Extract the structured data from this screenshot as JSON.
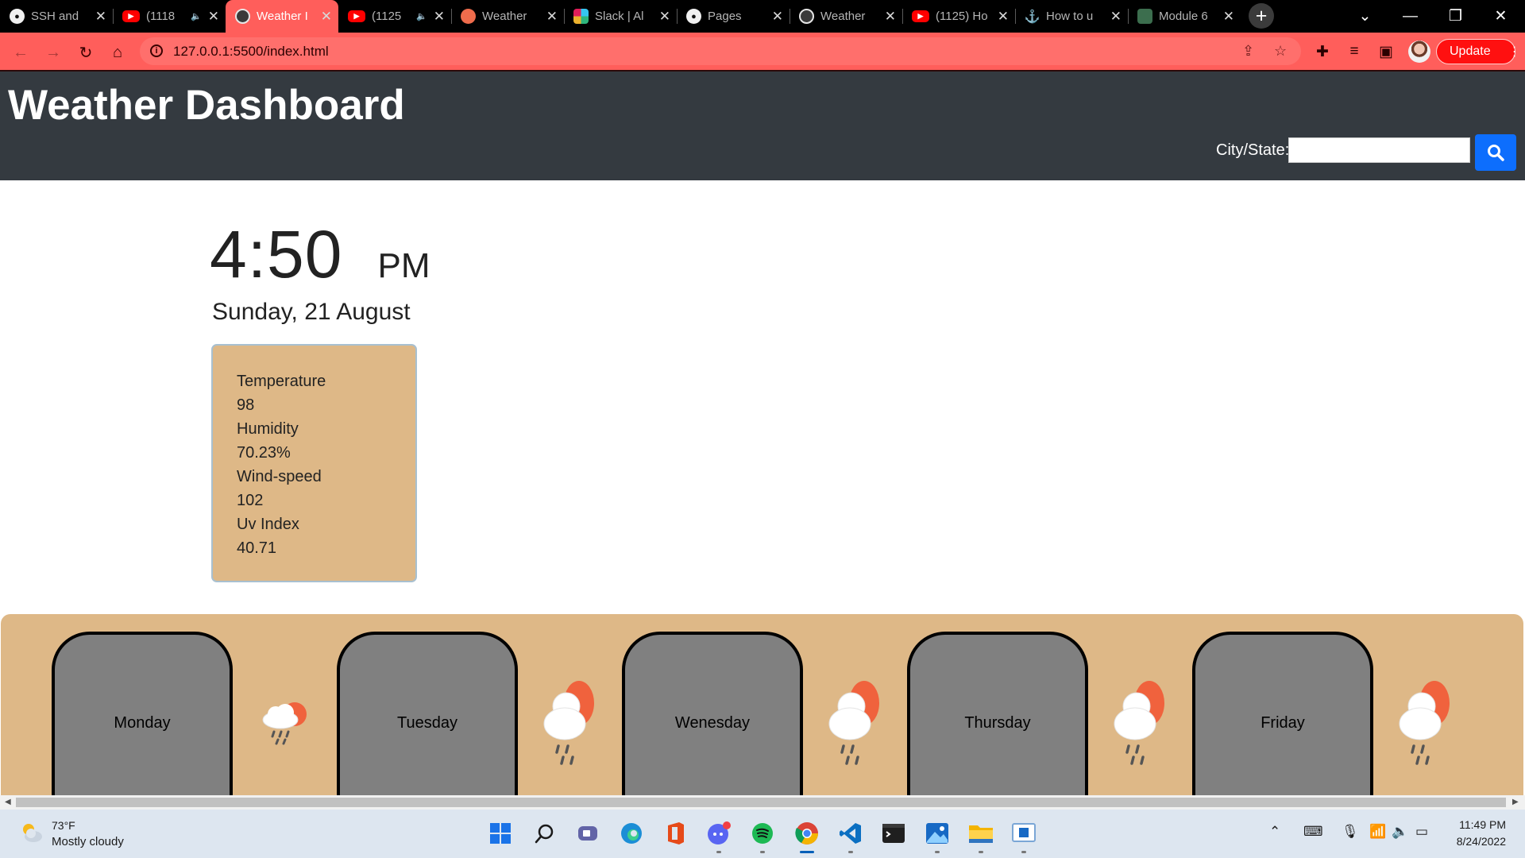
{
  "browser": {
    "tabs": [
      {
        "title": "SSH and",
        "icon": "github-icon",
        "audio": false
      },
      {
        "title": "(1118",
        "icon": "youtube-icon",
        "audio": true
      },
      {
        "title": "Weather I",
        "icon": "globe-icon",
        "audio": false,
        "active": true
      },
      {
        "title": "(1125",
        "icon": "youtube-icon",
        "audio": true
      },
      {
        "title": "Weather",
        "icon": "weather-app-icon",
        "audio": false
      },
      {
        "title": "Slack | Al",
        "icon": "slack-icon",
        "audio": false
      },
      {
        "title": "Pages",
        "icon": "github-icon",
        "audio": false
      },
      {
        "title": "Weather",
        "icon": "globe-icon",
        "audio": false
      },
      {
        "title": "(1125) Ho",
        "icon": "youtube-icon",
        "audio": false
      },
      {
        "title": "How to u",
        "icon": "anchor-icon",
        "audio": false
      },
      {
        "title": "Module 6",
        "icon": "module-icon",
        "audio": false
      }
    ],
    "url": "127.0.0.1:5500/index.html",
    "update_label": "Update",
    "theme_color": "#ff5e5b"
  },
  "page": {
    "title": "Weather Dashboard",
    "search": {
      "label": "City/State:",
      "value": ""
    },
    "clock": {
      "time": "4:50",
      "ampm": "PM"
    },
    "date": "Sunday, 21 August",
    "current": {
      "temperature_label": "Temperature",
      "temperature_value": "98",
      "humidity_label": "Humidity",
      "humidity_value": "70.23%",
      "wind_label": "Wind-speed",
      "wind_value": "102",
      "uv_label": "Uv Index",
      "uv_value": "40.71"
    },
    "forecast": [
      {
        "day": "Monday",
        "icon": "cloud-rain-sun-icon"
      },
      {
        "day": "Tuesday",
        "icon": "cloud-rain-sun-icon"
      },
      {
        "day": "Wenesday",
        "icon": "cloud-rain-sun-icon"
      },
      {
        "day": "Thursday",
        "icon": "cloud-rain-sun-icon"
      },
      {
        "day": "Friday",
        "icon": "cloud-rain-sun-icon"
      }
    ],
    "colors": {
      "header": "#343a40",
      "card": "#deb887",
      "day_card": "#808080",
      "search_button": "#0d6efd"
    }
  },
  "taskbar": {
    "weather_temp": "73°F",
    "weather_condition": "Mostly cloudy",
    "time": "11:49 PM",
    "date": "8/24/2022"
  }
}
